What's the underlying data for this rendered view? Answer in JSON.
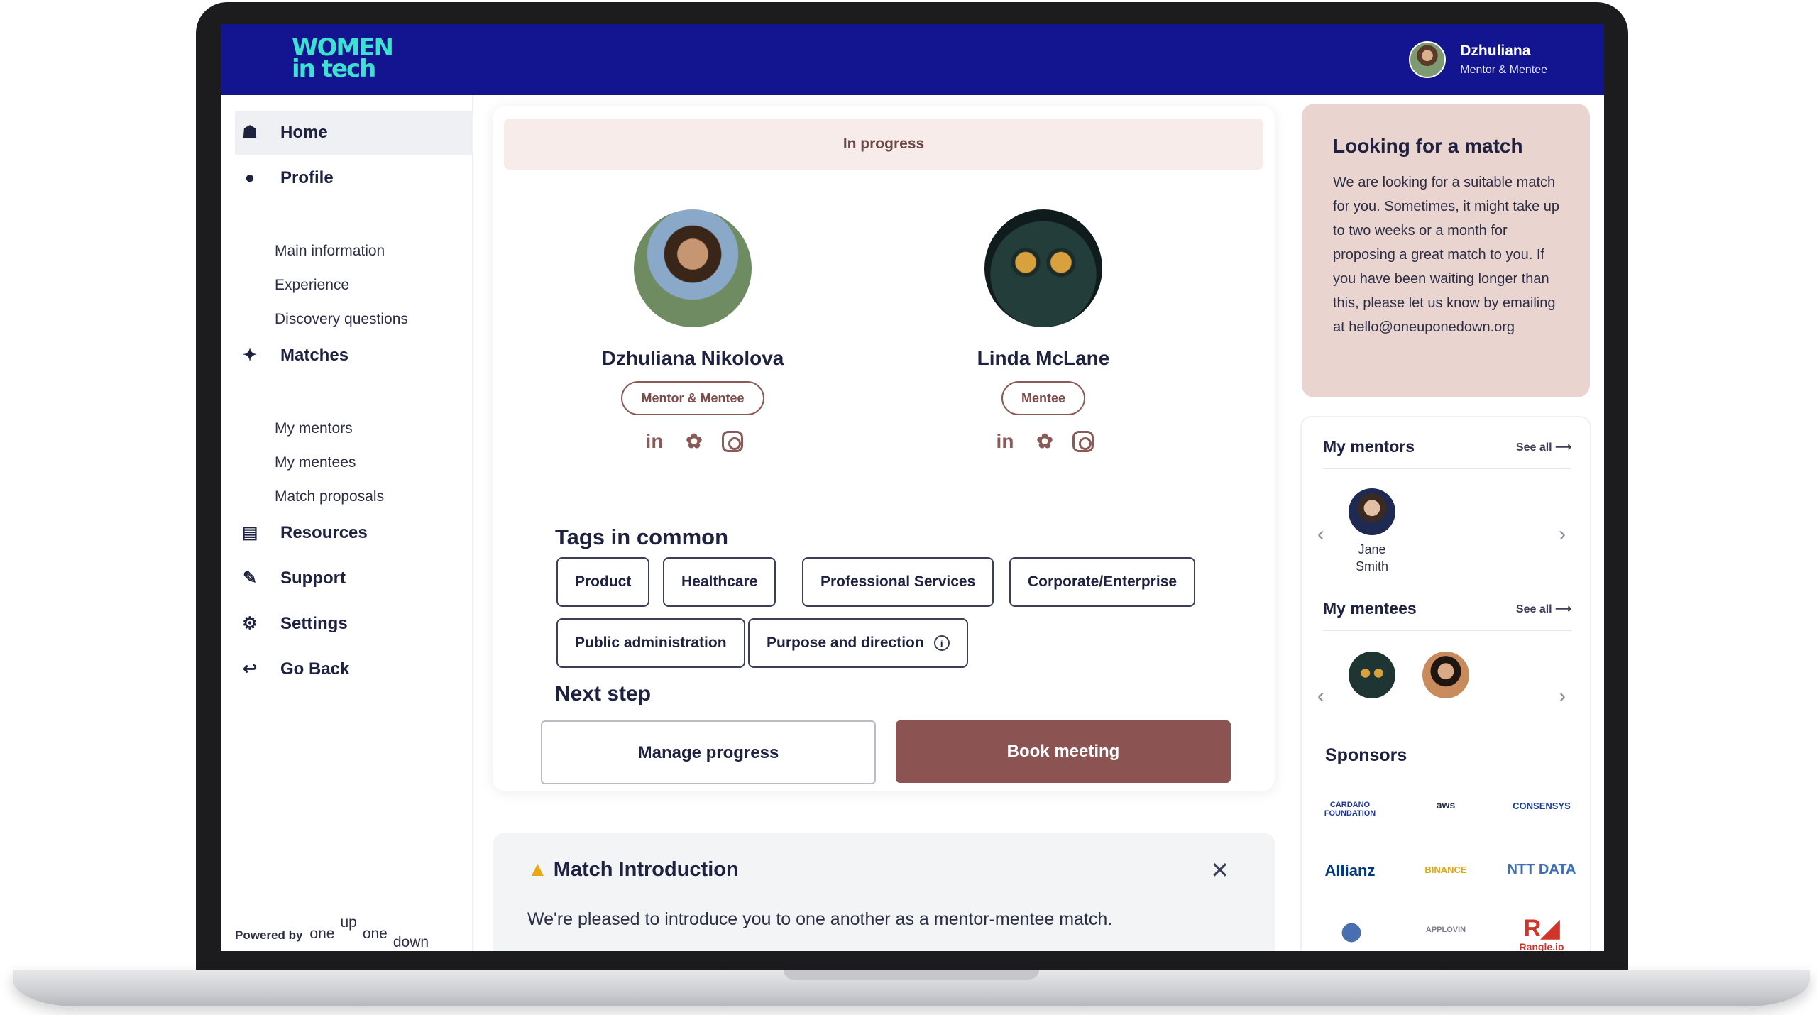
{
  "header": {
    "logo_line1": "WOMEN",
    "logo_line2": "in tech",
    "user_name": "Dzhuliana",
    "user_role": "Mentor & Mentee"
  },
  "sidebar": {
    "items": [
      {
        "label": "Home",
        "icon": "home-icon"
      },
      {
        "label": "Profile",
        "icon": "person-icon"
      },
      {
        "label": "Matches",
        "icon": "puzzle-icon"
      },
      {
        "label": "Resources",
        "icon": "book-icon"
      },
      {
        "label": "Support",
        "icon": "support-icon"
      },
      {
        "label": "Settings",
        "icon": "gear-icon"
      },
      {
        "label": "Go Back",
        "icon": "exit-icon"
      }
    ],
    "profile_sub": [
      "Main information",
      "Experience",
      "Discovery questions"
    ],
    "matches_sub": [
      "My mentors",
      "My mentees",
      "Match proposals"
    ],
    "powered_by": "Powered by",
    "brand_one": "one",
    "brand_up": "up",
    "brand_one2": "one",
    "brand_down": "down"
  },
  "match": {
    "status": "In progress",
    "person1": {
      "name": "Dzhuliana Nikolova",
      "role": "Mentor & Mentee"
    },
    "person2": {
      "name": "Linda McLane",
      "role": "Mentee"
    },
    "tags_title": "Tags in common",
    "tags": [
      "Product",
      "Healthcare",
      "Professional Services",
      "Corporate/Enterprise",
      "Public administration",
      "Purpose and direction"
    ],
    "next_step_title": "Next step",
    "manage_label": "Manage progress",
    "book_label": "Book meeting"
  },
  "intro": {
    "title": "Match Introduction",
    "text": "We're pleased to introduce you to one another as a mentor-mentee match."
  },
  "notice": {
    "title": "Looking for a match",
    "body": "We are looking for a suitable match for you. Sometimes, it might take up to two weeks or a month for proposing a great match to you. If you have been waiting longer than this, please let us know by emailing at hello@oneuponedown.org"
  },
  "mentors": {
    "title": "My mentors",
    "see_all": "See all",
    "items": [
      {
        "name_first": "Jane",
        "name_last": "Smith"
      }
    ]
  },
  "mentees": {
    "title": "My mentees",
    "see_all": "See all"
  },
  "sponsors": {
    "title": "Sponsors",
    "logos": [
      "CARDANO FOUNDATION",
      "aws",
      "CONSENSYS",
      "Allianz",
      "BINANCE",
      "NTT DATA",
      "",
      "APPLOVIN",
      "Rangle.io"
    ]
  },
  "colors": {
    "brand_navy": "#13148f",
    "accent_brown": "#8b5452",
    "notice_bg": "#ead4cf",
    "status_bg": "#f8ecea",
    "logo_teal": "#3ee0d0"
  }
}
